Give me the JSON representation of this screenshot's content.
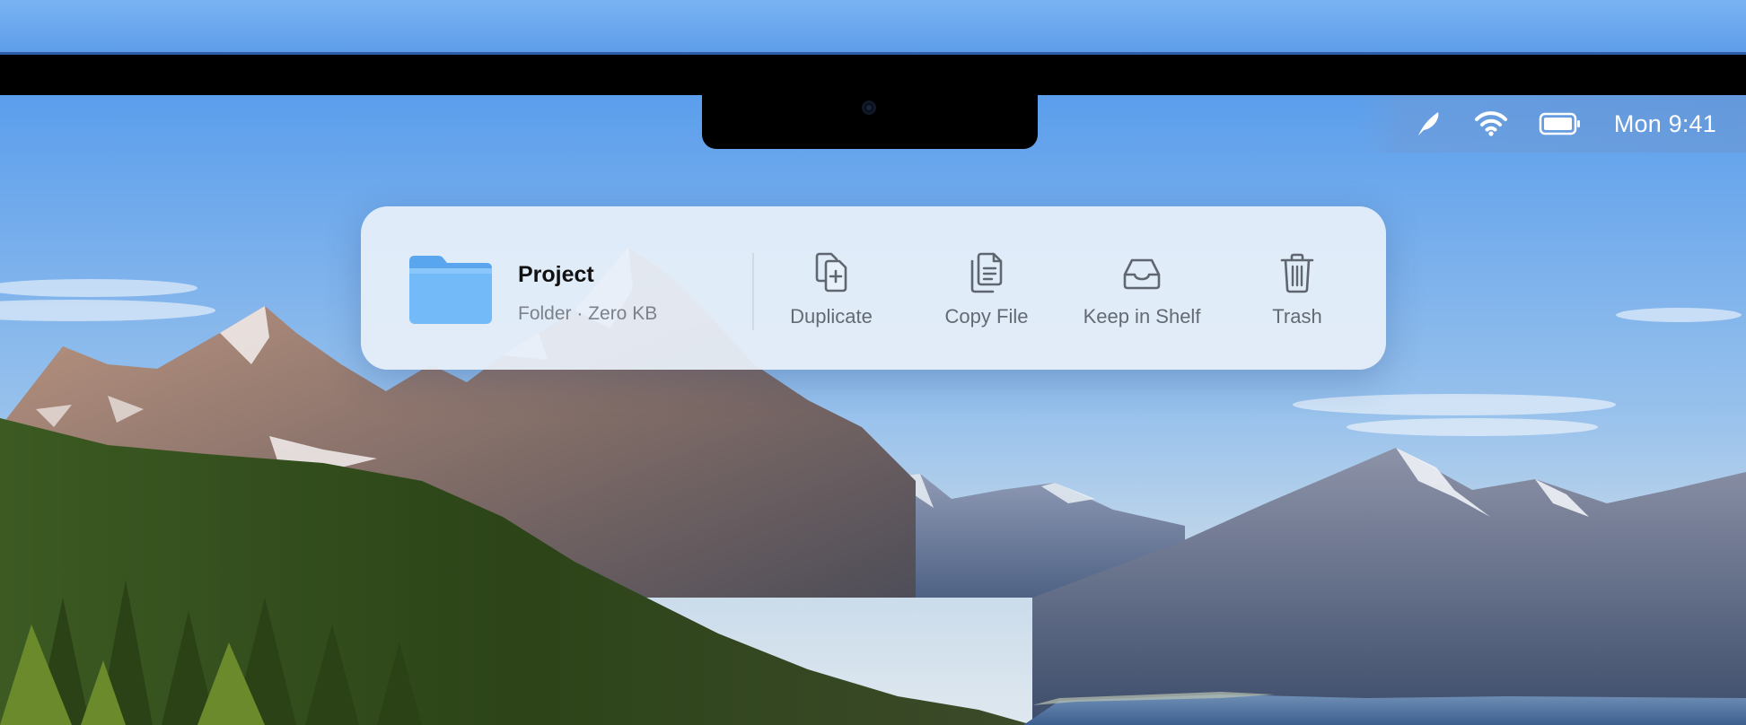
{
  "menubar": {
    "icons": [
      "feather-icon",
      "wifi-icon",
      "battery-icon"
    ],
    "clock": "Mon 9:41"
  },
  "file": {
    "name": "Project",
    "meta": "Folder · Zero KB",
    "icon": "folder-icon"
  },
  "actions": [
    {
      "label": "Duplicate",
      "icon": "duplicate-icon"
    },
    {
      "label": "Copy File",
      "icon": "copy-file-icon"
    },
    {
      "label": "Keep in Shelf",
      "icon": "tray-icon"
    },
    {
      "label": "Trash",
      "icon": "trash-icon"
    }
  ],
  "colors": {
    "sky": "#5e9de9",
    "folder": "#6bb6f8",
    "panel": "#e8f0fa",
    "icon_stroke": "#5f6670"
  }
}
